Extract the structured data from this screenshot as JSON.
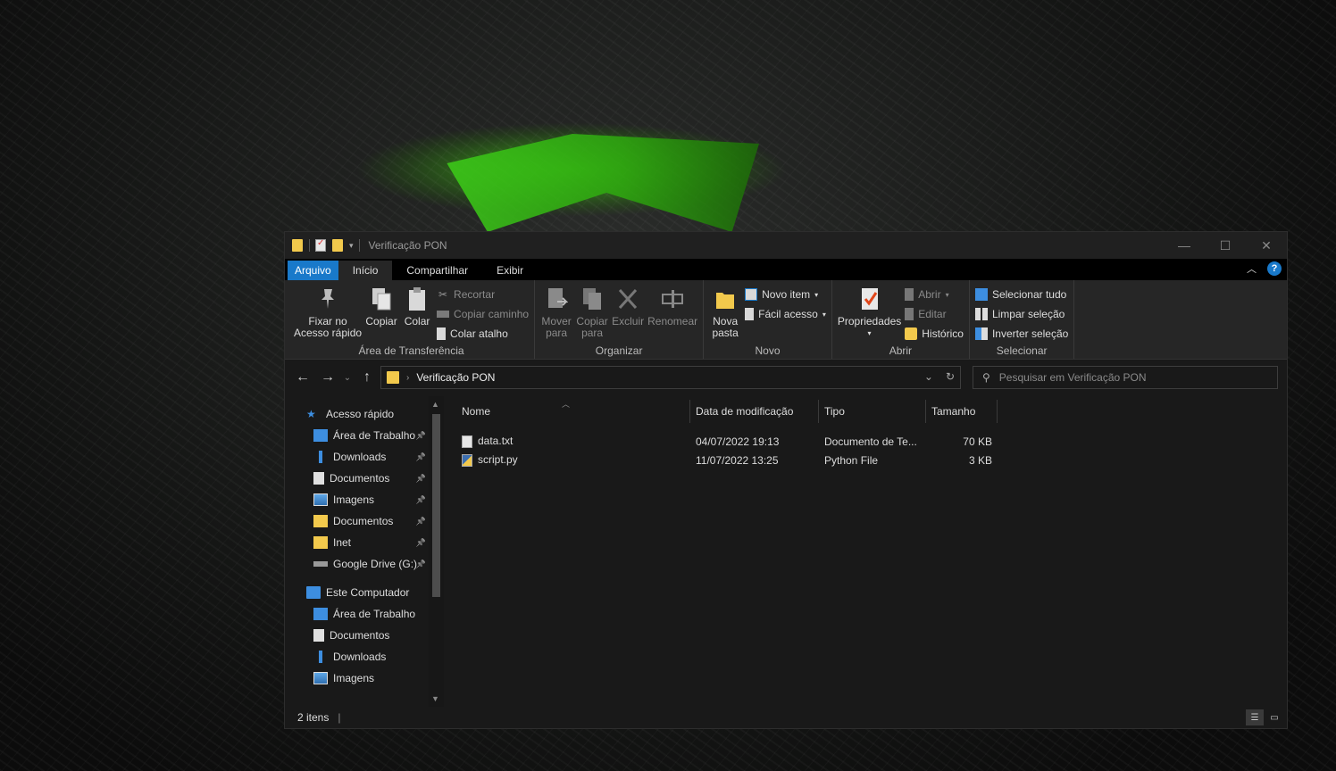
{
  "window": {
    "title": "Verificação PON",
    "controls": {
      "minimize": "—",
      "maximize": "☐",
      "close": "✕"
    }
  },
  "ribbon_tabs": [
    "Arquivo",
    "Início",
    "Compartilhar",
    "Exibir"
  ],
  "ribbon": {
    "clipboard": {
      "label": "Área de Transferência",
      "pin": "Fixar no\nAcesso rápido",
      "pin_line1": "Fixar no",
      "pin_line2": "Acesso rápido",
      "copy": "Copiar",
      "paste": "Colar",
      "cut": "Recortar",
      "copy_path": "Copiar caminho",
      "paste_shortcut": "Colar atalho"
    },
    "organize": {
      "label": "Organizar",
      "move_line1": "Mover",
      "move_line2": "para",
      "copy_line1": "Copiar",
      "copy_line2": "para",
      "delete": "Excluir",
      "rename": "Renomear"
    },
    "new": {
      "label": "Novo",
      "new_folder_line1": "Nova",
      "new_folder_line2": "pasta",
      "new_item": "Novo item",
      "easy_access": "Fácil acesso"
    },
    "open": {
      "label": "Abrir",
      "properties": "Propriedades",
      "open": "Abrir",
      "edit": "Editar",
      "history": "Histórico"
    },
    "select": {
      "label": "Selecionar",
      "select_all": "Selecionar tudo",
      "select_none": "Limpar seleção",
      "invert": "Inverter seleção"
    }
  },
  "address": {
    "path": "Verificação PON",
    "search_placeholder": "Pesquisar em Verificação PON"
  },
  "navpane": {
    "quick_access": "Acesso rápido",
    "quick_items": [
      {
        "label": "Área de Trabalho",
        "icon": "desktop-icon",
        "pinned": true
      },
      {
        "label": "Downloads",
        "icon": "download-icon",
        "pinned": true
      },
      {
        "label": "Documentos",
        "icon": "documents-icon",
        "pinned": true
      },
      {
        "label": "Imagens",
        "icon": "pictures-icon",
        "pinned": true
      },
      {
        "label": "Documentos",
        "icon": "folder-sync-icon",
        "pinned": true
      },
      {
        "label": "Inet",
        "icon": "folder-sync-icon",
        "pinned": true
      },
      {
        "label": "Google Drive (G:)",
        "icon": "drive-icon",
        "pinned": true
      }
    ],
    "this_pc": "Este Computador",
    "pc_items": [
      {
        "label": "Área de Trabalho",
        "icon": "desktop-icon"
      },
      {
        "label": "Documentos",
        "icon": "documents-icon"
      },
      {
        "label": "Downloads",
        "icon": "download-icon"
      },
      {
        "label": "Imagens",
        "icon": "pictures-icon"
      }
    ]
  },
  "columns": [
    "Nome",
    "Data de modificação",
    "Tipo",
    "Tamanho"
  ],
  "files": [
    {
      "name": "data.txt",
      "modified": "04/07/2022 19:13",
      "type": "Documento de Te...",
      "size": "70 KB",
      "icon": "text-file-icon"
    },
    {
      "name": "script.py",
      "modified": "11/07/2022 13:25",
      "type": "Python File",
      "size": "3 KB",
      "icon": "python-file-icon"
    }
  ],
  "status": {
    "count": "2 itens"
  },
  "colors": {
    "accent": "#1979ca",
    "folder": "#f2c94c",
    "window_bg": "#191919",
    "ribbon_bg": "#262626"
  }
}
